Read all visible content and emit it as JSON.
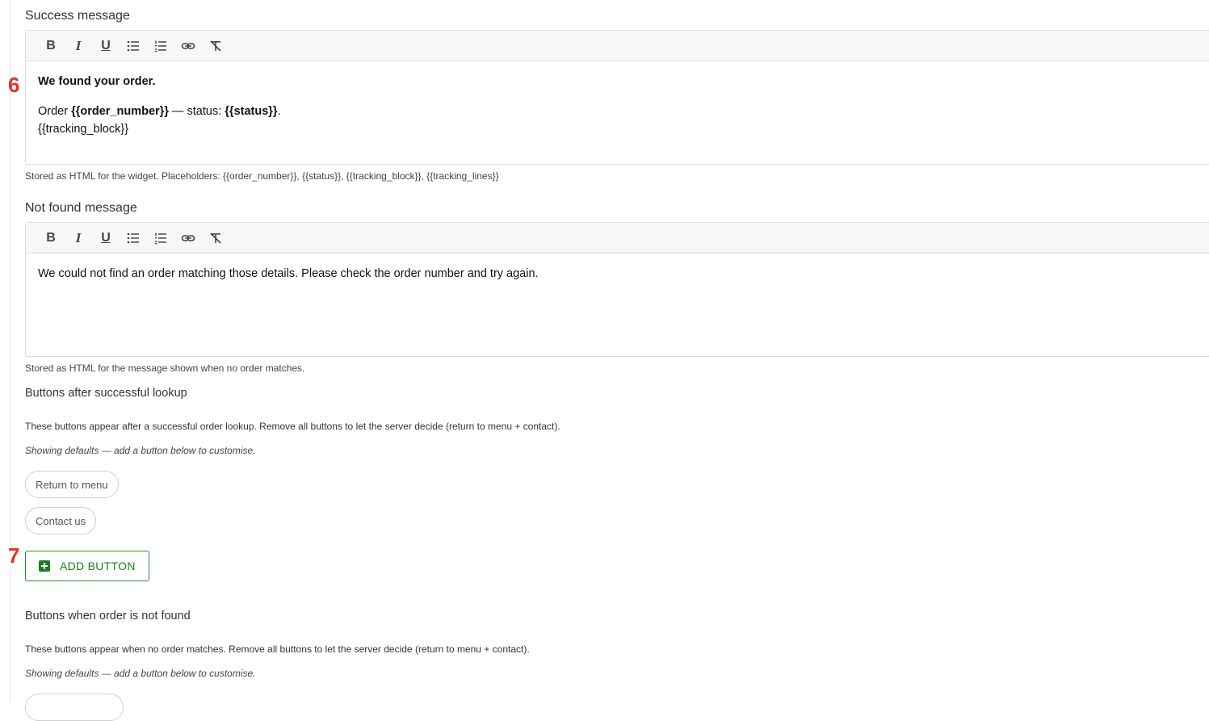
{
  "markers": {
    "m6": "6",
    "m7": "7"
  },
  "success": {
    "label": "Success message",
    "content": {
      "heading": "We found your order.",
      "line_prefix": "Order ",
      "order_placeholder": "{{order_number}}",
      "status_sep": " — status: ",
      "status_placeholder": "{{status}}",
      "period": ".",
      "tracking": "{{tracking_block}}"
    },
    "help": "Stored as HTML for the widget. Placeholders: {{order_number}}, {{status}}, {{tracking_block}}, {{tracking_lines}}"
  },
  "not_found": {
    "label": "Not found message",
    "content": "We could not find an order matching those details. Please check the order number and try again.",
    "help": "Stored as HTML for the message shown when no order matches."
  },
  "success_buttons": {
    "label": "Buttons after successful lookup",
    "desc": "These buttons appear after a successful order lookup. Remove all buttons to let the server decide (return to menu + contact).",
    "note": "Showing defaults — add a button below to customise.",
    "chips": [
      "Return to menu",
      "Contact us"
    ],
    "add_label": "ADD BUTTON"
  },
  "notfound_buttons": {
    "label": "Buttons when order is not found",
    "desc": "These buttons appear when no order matches. Remove all buttons to let the server decide (return to menu + contact).",
    "note": "Showing defaults — add a button below to customise."
  },
  "toolbar": {
    "bold": "B",
    "italic": "I",
    "underline": "U"
  },
  "icons": [
    "bold-icon",
    "italic-icon",
    "underline-icon",
    "bullet-list-icon",
    "numbered-list-icon",
    "link-icon",
    "clear-format-icon"
  ],
  "colors": {
    "accent_green": "#1e7e1e",
    "marker_red": "#e0352b"
  }
}
